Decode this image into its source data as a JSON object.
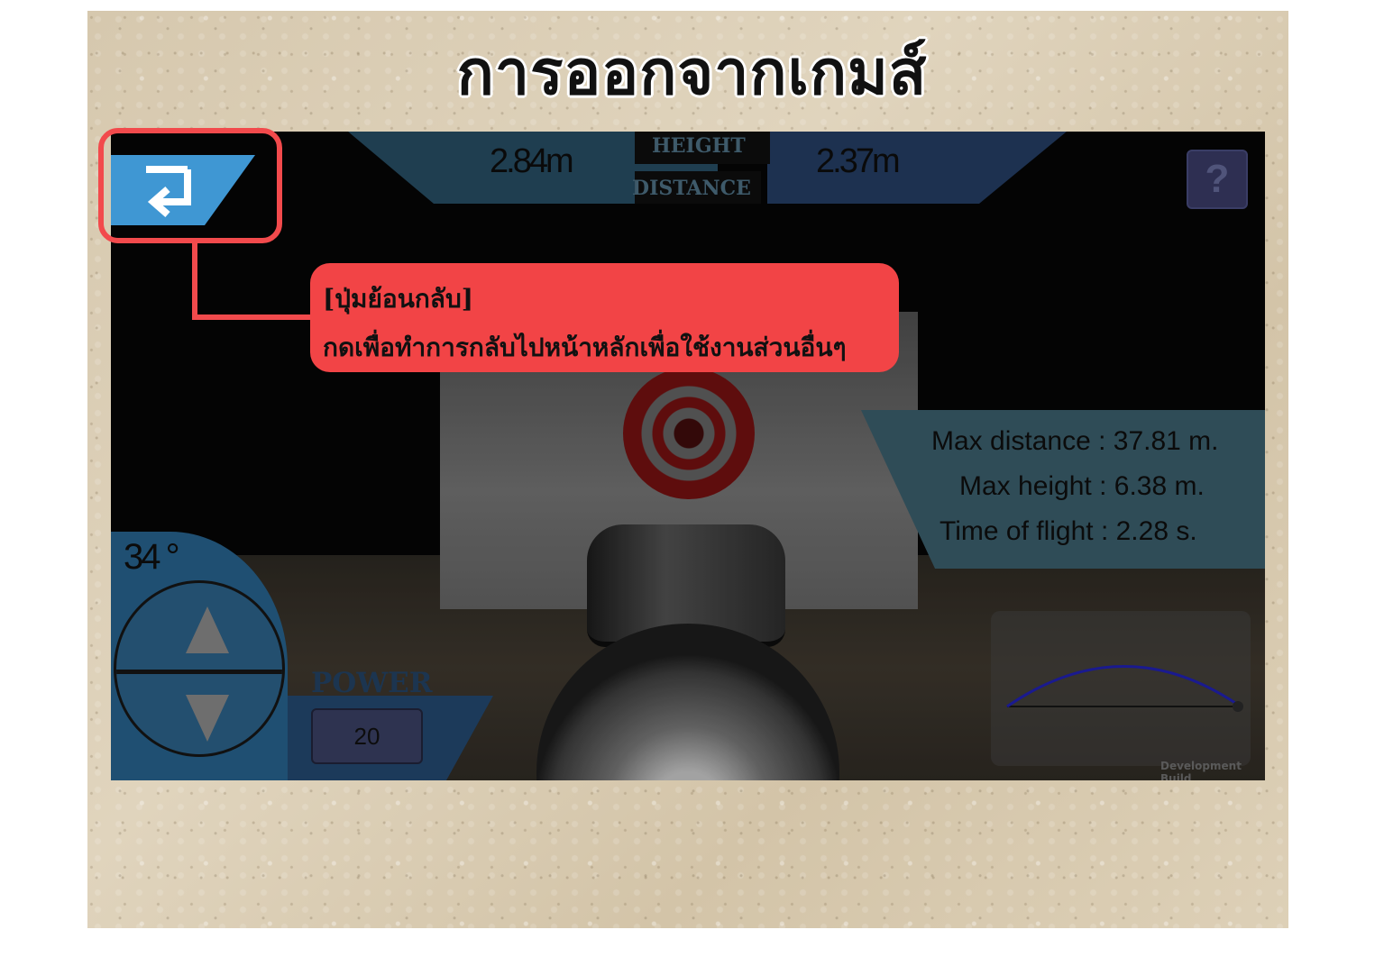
{
  "slide": {
    "title": "การออกจากเกมส์"
  },
  "hud": {
    "height_value": "2.84m",
    "height_label": "HEIGHT",
    "distance_label": "DISTANCE",
    "distance_value": "2.37m",
    "help_label": "?",
    "back_icon": "return-arrow-icon"
  },
  "stats": {
    "max_distance": "Max distance : 37.81 m.",
    "max_height": "Max height : 6.38 m.",
    "time_of_flight": "Time of flight : 2.28 s."
  },
  "controls": {
    "angle": "34 °",
    "power_label": "POWER",
    "power_value": "20"
  },
  "trajectory": {
    "line_color": "#1a1a8f"
  },
  "footer": {
    "dev_build": "Development Build"
  },
  "callout": {
    "title": "[ปุ่มย้อนกลับ]",
    "description": "กดเพื่อทำการกลับไปหน้าหลักเพื่อใช้งานส่วนอื่นๆ",
    "color": "#f24446"
  }
}
